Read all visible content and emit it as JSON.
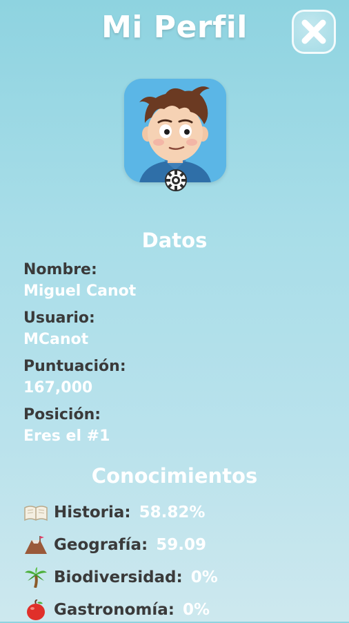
{
  "header": {
    "title": "Mi Perfil"
  },
  "icons": {
    "close": "close-icon",
    "gear": "gear-icon"
  },
  "datos": {
    "section_title": "Datos",
    "nombre_label": "Nombre:",
    "nombre_value": "Miguel Canot",
    "usuario_label": "Usuario:",
    "usuario_value": "MCanot",
    "puntuacion_label": "Puntuación:",
    "puntuacion_value": "167,000",
    "posicion_label": "Posición:",
    "posicion_value": "Eres el #1"
  },
  "conocimientos": {
    "section_title": "Conocimientos",
    "items": [
      {
        "icon": "book-icon",
        "name": "Historia:",
        "value": "58.82%"
      },
      {
        "icon": "volcano-icon",
        "name": "Geografía:",
        "value": "59.09"
      },
      {
        "icon": "palm-tree-icon",
        "name": "Biodiversidad:",
        "value": "0%"
      },
      {
        "icon": "apple-icon",
        "name": "Gastronomía:",
        "value": "0%"
      }
    ]
  },
  "colors": {
    "background_top": "#8ed3e0",
    "background_bottom": "#cde8ee",
    "label_text": "#3a3a3a",
    "value_text": "#ffffff",
    "avatar_bg": "#5bb6e6"
  }
}
